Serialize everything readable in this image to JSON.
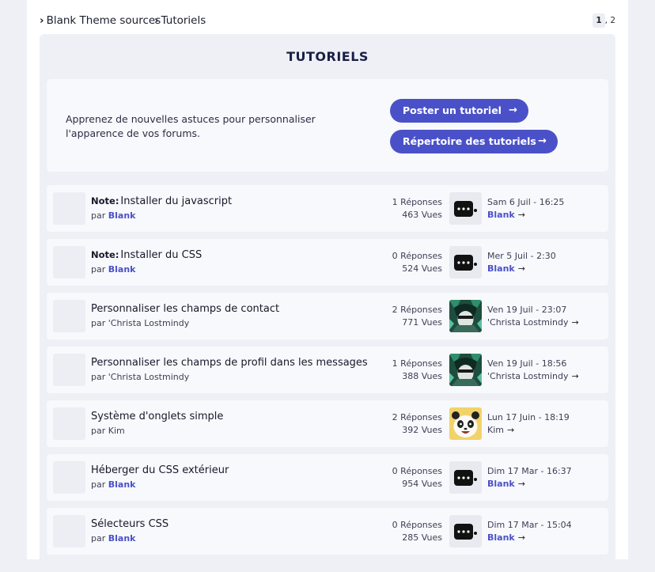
{
  "breadcrumb": [
    "Blank Theme sources",
    "Tutoriels"
  ],
  "breadcrumb_sep": "›",
  "pagination": {
    "current": "1",
    "sep": ",",
    "next": "2"
  },
  "forum": {
    "title": "TUTORIELS",
    "description": "Apprenez de nouvelles astuces pour personnaliser l'apparence de vos forums.",
    "buttons": [
      "Poster un tutoriel",
      "Répertoire des tutoriels"
    ]
  },
  "labels": {
    "by": "par",
    "arrow": "→"
  },
  "topics": [
    {
      "prefix": "Note:",
      "title": "Installer du javascript",
      "author": "Blank",
      "author_style": "link",
      "replies": "1 Réponses",
      "views": "463 Vues",
      "last_date": "Sam 6 Juil - 16:25",
      "last_author": "Blank",
      "last_style": "link",
      "avatar": "default"
    },
    {
      "prefix": "Note:",
      "title": "Installer du CSS",
      "author": "Blank",
      "author_style": "link",
      "replies": "0 Réponses",
      "views": "524 Vues",
      "last_date": "Mer 5 Juil - 2:30",
      "last_author": "Blank",
      "last_style": "link",
      "avatar": "default"
    },
    {
      "prefix": "",
      "title": "Personnaliser les champs de contact",
      "author": "'Christa Lostmindy",
      "author_style": "plain",
      "replies": "2 Réponses",
      "views": "771 Vues",
      "last_date": "Ven 19 Juil - 23:07",
      "last_author": "'Christa Lostmindy",
      "last_style": "plain",
      "avatar": "anime-green"
    },
    {
      "prefix": "",
      "title": "Personnaliser les champs de profil dans les messages",
      "author": "'Christa Lostmindy",
      "author_style": "plain",
      "replies": "1 Réponses",
      "views": "388 Vues",
      "last_date": "Ven 19 Juil - 18:56",
      "last_author": "'Christa Lostmindy",
      "last_style": "plain",
      "avatar": "anime-green"
    },
    {
      "prefix": "",
      "title": "Système d'onglets simple",
      "author": "Kim",
      "author_style": "plain",
      "replies": "2 Réponses",
      "views": "392 Vues",
      "last_date": "Lun 17 Juin - 18:19",
      "last_author": "Kim",
      "last_style": "plain",
      "avatar": "panda"
    },
    {
      "prefix": "",
      "title": "Héberger du CSS extérieur",
      "author": "Blank",
      "author_style": "link",
      "replies": "0 Réponses",
      "views": "954 Vues",
      "last_date": "Dim 17 Mar - 16:37",
      "last_author": "Blank",
      "last_style": "link",
      "avatar": "default"
    },
    {
      "prefix": "",
      "title": "Sélecteurs CSS",
      "author": "Blank",
      "author_style": "link",
      "replies": "0 Réponses",
      "views": "285 Vues",
      "last_date": "Dim 17 Mar - 15:04",
      "last_author": "Blank",
      "last_style": "link",
      "avatar": "default"
    }
  ],
  "colors": {
    "accent": "#4a51c8",
    "panel": "#eef0f6",
    "card": "#f8f9fc"
  }
}
